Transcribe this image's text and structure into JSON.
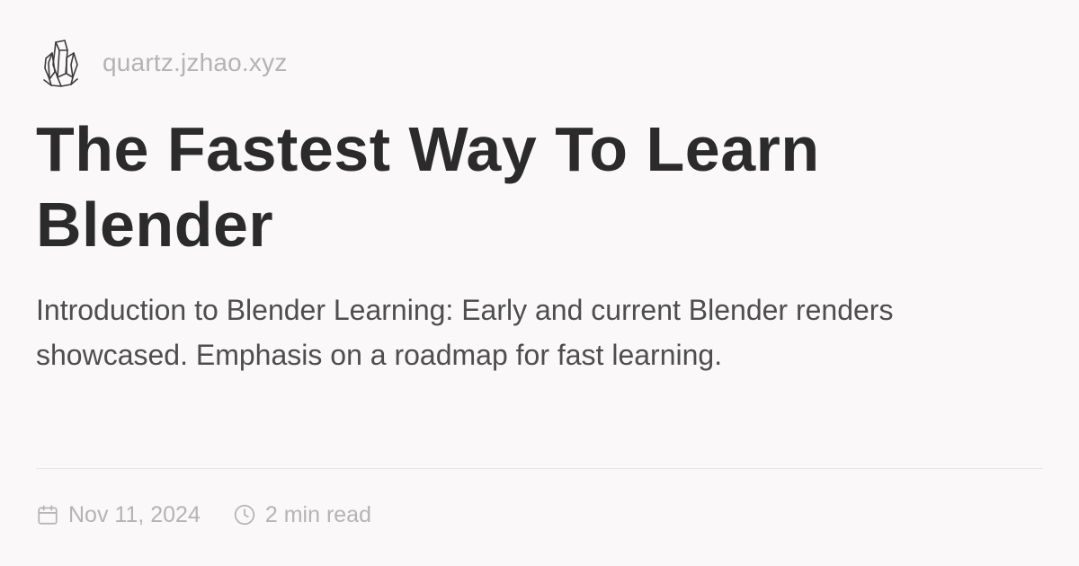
{
  "header": {
    "logo_icon": "crystal-logo-icon",
    "site_name": "quartz.jzhao.xyz"
  },
  "article": {
    "title": "The Fastest Way To Learn Blender",
    "description": "Introduction to Blender Learning: Early and current Blender renders showcased. Emphasis on a roadmap for fast learning."
  },
  "meta": {
    "date_icon": "calendar-icon",
    "date": "Nov 11, 2024",
    "reading_time_icon": "clock-icon",
    "reading_time": "2 min read"
  },
  "colors": {
    "background": "#faf8f8",
    "title": "#2b2b2b",
    "body_text": "#4e4e4e",
    "muted_text": "#b5b3b3",
    "divider": "#e6e4e4"
  }
}
